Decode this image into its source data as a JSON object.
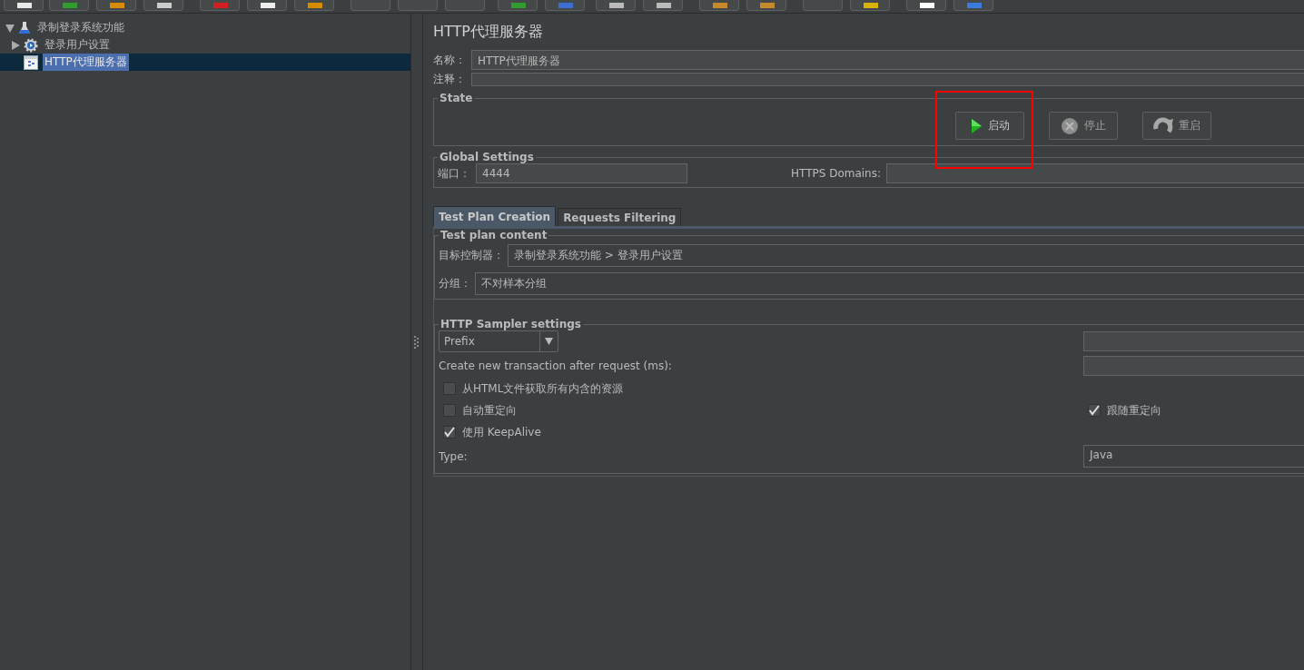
{
  "tree": [
    {
      "label": "录制登录系统功能",
      "kind": "plan",
      "expanded": true,
      "selected": false,
      "children": [
        {
          "label": "登录用户设置",
          "kind": "config",
          "expanded": false,
          "selected": false
        },
        {
          "label": "HTTP代理服务器",
          "kind": "proxy",
          "selected": true
        }
      ]
    }
  ],
  "title": "HTTP代理服务器",
  "name_field": {
    "label": "名称：",
    "value": "HTTP代理服务器"
  },
  "comment_field": {
    "label": "注释："
  },
  "state": {
    "legend": "State",
    "buttons": [
      {
        "label": "启动",
        "kind": "start",
        "disabled": false,
        "highlighted": true
      },
      {
        "label": "停止",
        "kind": "stop",
        "disabled": true,
        "highlighted": false
      },
      {
        "label": "重启",
        "kind": "restart",
        "disabled": true,
        "highlighted": false
      }
    ]
  },
  "global_settings": {
    "legend": "Global Settings",
    "port": {
      "label": "端口：",
      "value": "4444"
    },
    "https_domains": {
      "label": "HTTPS Domains:"
    }
  },
  "tabs": [
    {
      "label": "Test Plan Creation",
      "selected": true
    },
    {
      "label": "Requests Filtering",
      "selected": false
    }
  ],
  "test_plan_content": {
    "legend": "Test plan content",
    "target_controller": {
      "label": "目标控制器：",
      "value": "录制登录系统功能 > 登录用户设置"
    },
    "grouping": {
      "label": "分组：",
      "value": "不对样本分组"
    }
  },
  "sampler_settings": {
    "legend": "HTTP Sampler settings",
    "naming": {
      "value": "Prefix"
    },
    "transaction_label": "Create new transaction after request (ms):",
    "checkbox_rows": [
      [
        {
          "label": "从HTML文件获取所有内含的资源",
          "checked": false
        }
      ],
      [
        {
          "label": "自动重定向",
          "checked": false
        },
        {
          "label": "跟随重定向",
          "checked": true
        }
      ],
      [
        {
          "label": "使用 KeepAlive",
          "checked": true
        }
      ]
    ],
    "type": {
      "label": "Type:",
      "value": "Java"
    }
  }
}
